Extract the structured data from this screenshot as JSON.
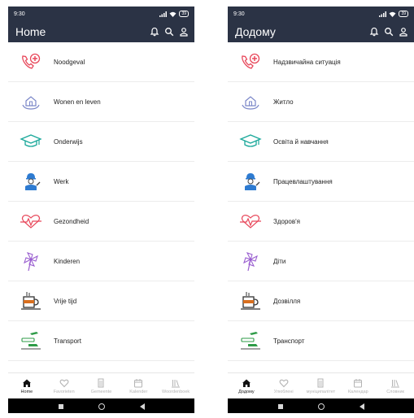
{
  "screens": [
    {
      "status": {
        "time": "9:30",
        "battery": "39"
      },
      "title": "Home",
      "items": [
        {
          "label": "Noodgeval",
          "icon": "emergency-phone-icon"
        },
        {
          "label": "Wonen en leven",
          "icon": "housing-icon"
        },
        {
          "label": "Onderwijs",
          "icon": "graduation-cap-icon"
        },
        {
          "label": "Werk",
          "icon": "worker-icon"
        },
        {
          "label": "Gezondheid",
          "icon": "heart-pulse-icon"
        },
        {
          "label": "Kinderen",
          "icon": "pinwheel-icon"
        },
        {
          "label": "Vrije tijd",
          "icon": "coffee-cup-icon"
        },
        {
          "label": "Transport",
          "icon": "transport-icon"
        }
      ],
      "nav": [
        {
          "label": "Home",
          "icon": "home-icon",
          "active": true
        },
        {
          "label": "Favorieten",
          "icon": "heart-icon"
        },
        {
          "label": "Gemeente",
          "icon": "building-icon"
        },
        {
          "label": "Kalender",
          "icon": "calendar-icon"
        },
        {
          "label": "Woordenboek",
          "icon": "dictionary-icon"
        }
      ]
    },
    {
      "status": {
        "time": "9:30",
        "battery": "39"
      },
      "title": "Додому",
      "items": [
        {
          "label": "Надзвичайна ситуація",
          "icon": "emergency-phone-icon"
        },
        {
          "label": "Житло",
          "icon": "housing-icon"
        },
        {
          "label": "Освіта й навчання",
          "icon": "graduation-cap-icon"
        },
        {
          "label": "Працевлаштування",
          "icon": "worker-icon"
        },
        {
          "label": "Здоров'я",
          "icon": "heart-pulse-icon"
        },
        {
          "label": "Діти",
          "icon": "pinwheel-icon"
        },
        {
          "label": "Дозвілля",
          "icon": "coffee-cup-icon"
        },
        {
          "label": "Транспорт",
          "icon": "transport-icon"
        }
      ],
      "nav": [
        {
          "label": "Додому",
          "icon": "home-icon",
          "active": true
        },
        {
          "label": "Улюблені",
          "icon": "heart-icon"
        },
        {
          "label": "муніципалітет",
          "icon": "building-icon"
        },
        {
          "label": "Календар",
          "icon": "calendar-icon"
        },
        {
          "label": "Словник",
          "icon": "dictionary-icon"
        }
      ]
    }
  ],
  "colors": {
    "app_bar": "#2b3345",
    "emergency": "#e8485b",
    "housing": "#7a86c8",
    "education": "#1aa89a",
    "work": "#2e7bd1",
    "health": "#e8485b",
    "children": "#9a5fd0",
    "leisure": "#d86f1f",
    "transport": "#2e9b47"
  }
}
